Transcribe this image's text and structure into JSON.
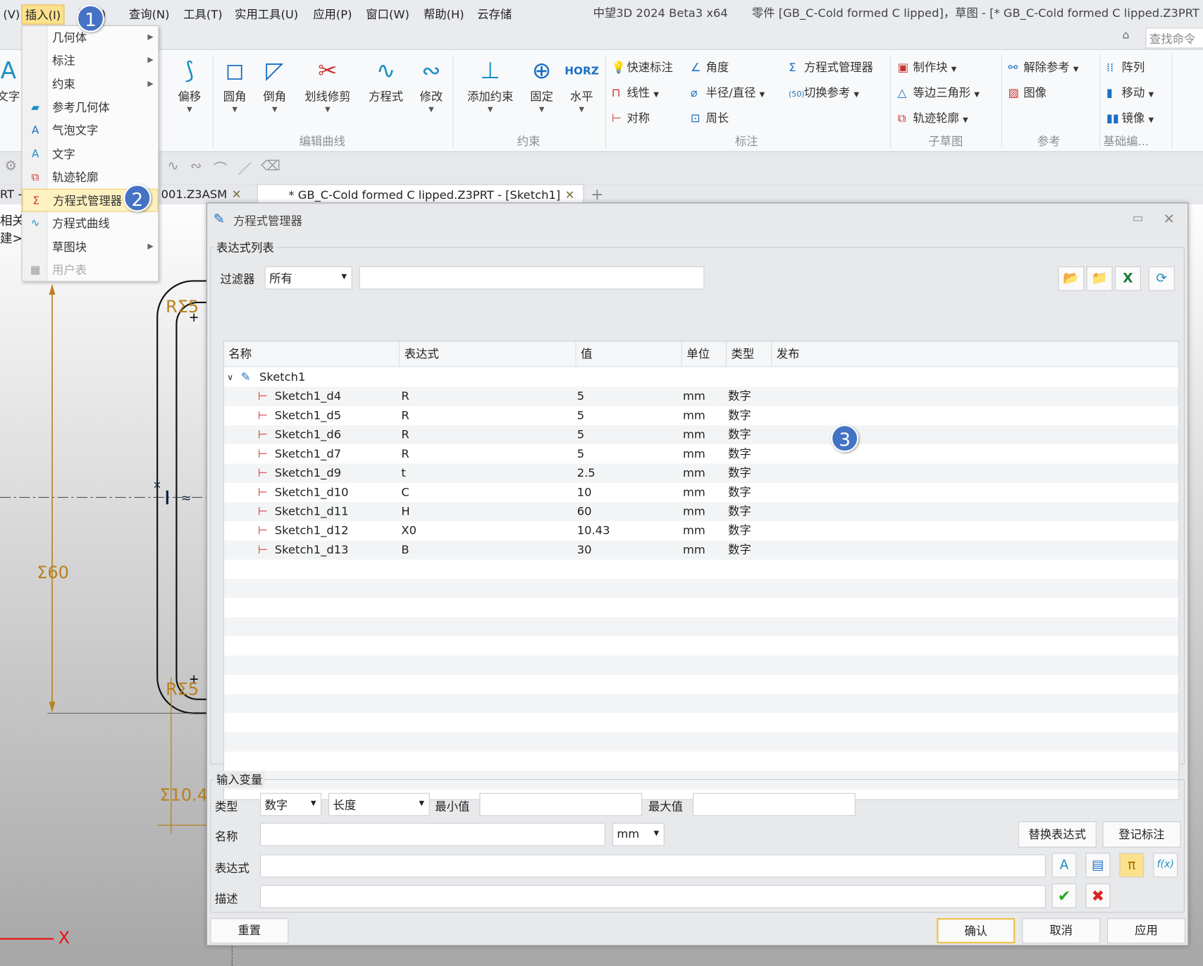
{
  "menu": {
    "items": [
      "(V)",
      "插入(I)",
      "尺(A)",
      "查询(N)",
      "工具(T)",
      "实用工具(U)",
      "应用(P)",
      "窗口(W)",
      "帮助(H)",
      "云存储"
    ],
    "app_title": "中望3D 2024 Beta3 x64",
    "doc_title": "零件 [GB_C-Cold formed C lipped]，草图 - [* GB_C-Cold formed C lipped.Z3PRT -",
    "search_placeholder": "查找命令"
  },
  "ribbon": {
    "left_partial": "文字",
    "edit_curve": {
      "group": "编辑曲线",
      "buttons": [
        "偏移",
        "圆角",
        "倒角",
        "划线修剪",
        "方程式",
        "修改"
      ]
    },
    "constraint": {
      "group": "约束",
      "buttons": [
        "添加约束",
        "固定",
        "水平"
      ],
      "horz_icon": "HORZ"
    },
    "dimension": {
      "group": "标注",
      "items": [
        "快速标注",
        "角度",
        "方程式管理器",
        "线性",
        "半径/直径",
        "切换参考",
        "对称",
        "周长"
      ]
    },
    "subsketch": {
      "group": "子草图",
      "items": [
        "制作块",
        "等边三角形",
        "轨迹轮廓"
      ]
    },
    "reference": {
      "group": "参考",
      "items": [
        "解除参考",
        "图像"
      ]
    },
    "basic_edit": {
      "group": "基础编...",
      "items": [
        "阵列",
        "移动",
        "镜像"
      ]
    }
  },
  "tabs": [
    {
      "label": "RT -"
    },
    {
      "label": "001.Z3ASM"
    },
    {
      "label": "* GB_C-Cold formed C lipped.Z3PRT - [Sketch1]"
    }
  ],
  "canvas": {
    "side_text": [
      "相关",
      "建>显"
    ],
    "dims": [
      "RΣ5",
      "Σ60",
      "RΣ5",
      "Σ10.4"
    ],
    "axis": "X"
  },
  "insert_menu": {
    "items": [
      {
        "label": "几何体",
        "sub": true,
        "icon": ""
      },
      {
        "label": "标注",
        "sub": true,
        "icon": ""
      },
      {
        "label": "约束",
        "sub": true,
        "icon": ""
      },
      {
        "label": "参考几何体",
        "icon": "reference-geometry"
      },
      {
        "label": "气泡文字",
        "icon": "balloon-text"
      },
      {
        "label": "文字",
        "icon": "text"
      },
      {
        "label": "轨迹轮廓",
        "icon": "trace-profile"
      },
      {
        "label": "方程式管理器",
        "icon": "sigma",
        "highlighted": true
      },
      {
        "label": "方程式曲线",
        "icon": "equation-curve"
      },
      {
        "label": "草图块",
        "sub": true,
        "icon": ""
      },
      {
        "label": "用户表",
        "icon": "table",
        "disabled": true
      }
    ]
  },
  "badges": [
    "1",
    "2",
    "3"
  ],
  "dialog": {
    "title": "方程式管理器",
    "list_group": "表达式列表",
    "filter_label": "过滤器",
    "filter_value": "所有",
    "filter_text": "",
    "columns": [
      "名称",
      "表达式",
      "值",
      "单位",
      "类型",
      "发布"
    ],
    "root": "Sketch1",
    "rows": [
      {
        "name": "Sketch1_d4",
        "expr": "R",
        "value": "5",
        "unit": "mm",
        "type": "数字"
      },
      {
        "name": "Sketch1_d5",
        "expr": "R",
        "value": "5",
        "unit": "mm",
        "type": "数字"
      },
      {
        "name": "Sketch1_d6",
        "expr": "R",
        "value": "5",
        "unit": "mm",
        "type": "数字"
      },
      {
        "name": "Sketch1_d7",
        "expr": "R",
        "value": "5",
        "unit": "mm",
        "type": "数字"
      },
      {
        "name": "Sketch1_d9",
        "expr": "t",
        "value": "2.5",
        "unit": "mm",
        "type": "数字"
      },
      {
        "name": "Sketch1_d10",
        "expr": "C",
        "value": "10",
        "unit": "mm",
        "type": "数字"
      },
      {
        "name": "Sketch1_d11",
        "expr": "H",
        "value": "60",
        "unit": "mm",
        "type": "数字"
      },
      {
        "name": "Sketch1_d12",
        "expr": "X0",
        "value": "10.43",
        "unit": "mm",
        "type": "数字"
      },
      {
        "name": "Sketch1_d13",
        "expr": "B",
        "value": "30",
        "unit": "mm",
        "type": "数字"
      }
    ],
    "input_group": "输入变量",
    "type_label": "类型",
    "type_value": "数字",
    "kind_value": "长度",
    "min_label": "最小值",
    "max_label": "最大值",
    "name_label": "名称",
    "unit_value": "mm",
    "replace_btn": "替换表达式",
    "register_btn": "登记标注",
    "expr_label": "表达式",
    "desc_label": "描述",
    "reset": "重置",
    "ok": "确认",
    "cancel": "取消",
    "apply": "应用"
  },
  "colors": {
    "accent": "#4472c4",
    "highlight": "#fbe18c",
    "dimension": "#b8801e"
  }
}
